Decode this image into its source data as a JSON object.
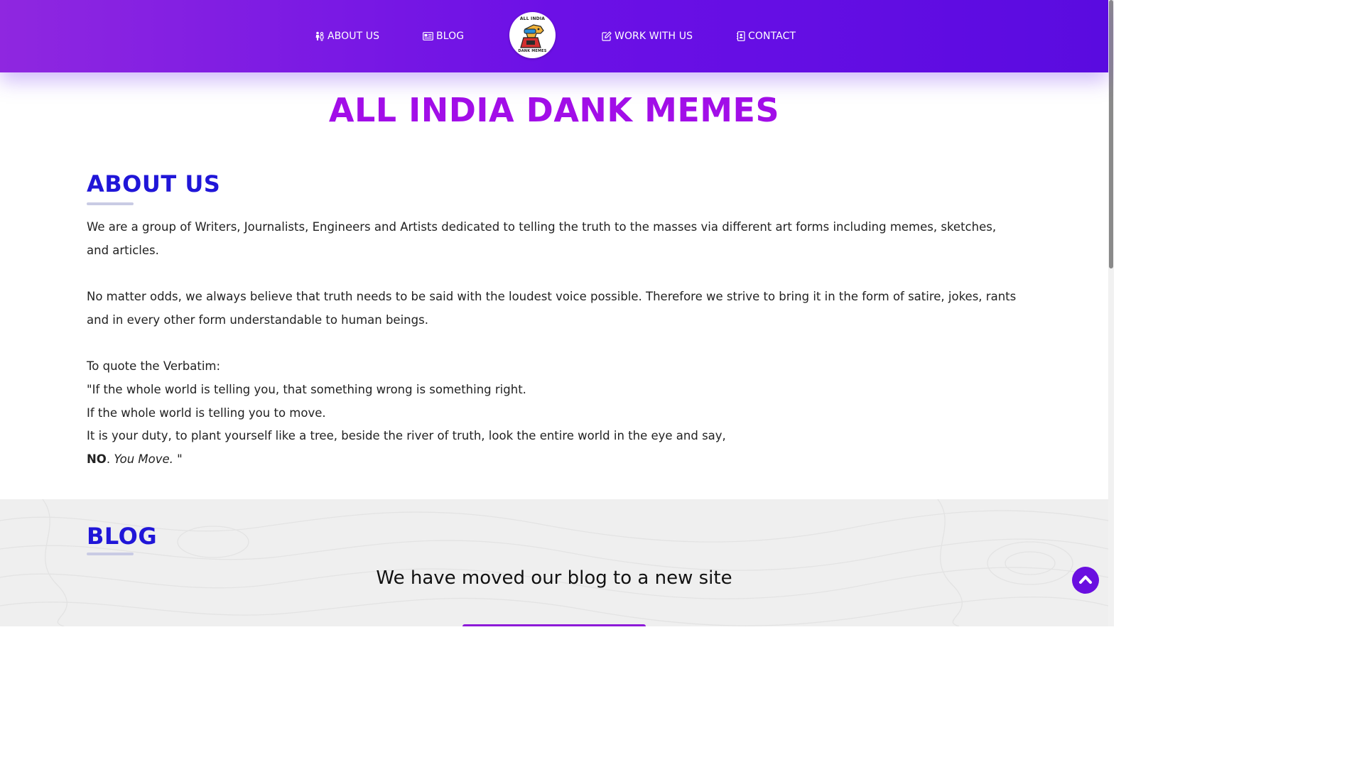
{
  "nav": {
    "about": {
      "label": "ABOUT US",
      "icon": "people-icon"
    },
    "blog": {
      "label": "BLOG",
      "icon": "newspaper-icon"
    },
    "work": {
      "label": "WORK WITH US",
      "icon": "edit-icon"
    },
    "contact": {
      "label": "CONTACT",
      "icon": "address-book-icon"
    },
    "logo": {
      "top_text": "ALL INDIA",
      "bottom_text": "DANK MEMES"
    }
  },
  "site_title": "ALL INDIA DANK MEMES",
  "about": {
    "heading": "ABOUT US",
    "p1": "We are a group of Writers, Journalists, Engineers and Artists dedicated to telling the truth to the masses via different art forms including memes, sketches, and articles.",
    "p2": "No matter odds, we always believe that truth needs to be said with the loudest voice possible. Therefore we strive to bring it in the form of satire, jokes, rants and in every other form understandable to human beings.",
    "quote_intro": "To quote the Verbatim:",
    "quote_line1": "\"If the whole world is telling you, that something wrong is something right.",
    "quote_line2": "If the whole world is telling you to move.",
    "quote_line3": "It is your duty, to plant yourself like a tree, beside the river of truth, look the entire world in the eye and say,",
    "quote_no": "NO",
    "quote_sep": ". ",
    "quote_you_move": "You Move.",
    "quote_end": " \""
  },
  "blog": {
    "heading": "BLOG",
    "subtitle": "We have moved our blog to a new site"
  },
  "colors": {
    "nav_gradient_start": "#8f27e0",
    "nav_gradient_end": "#5a0be0",
    "title": "#a20ee8",
    "heading": "#2016d8",
    "back_to_top": "#6a0fe0"
  },
  "back_to_top_icon": "chevron-up-icon"
}
